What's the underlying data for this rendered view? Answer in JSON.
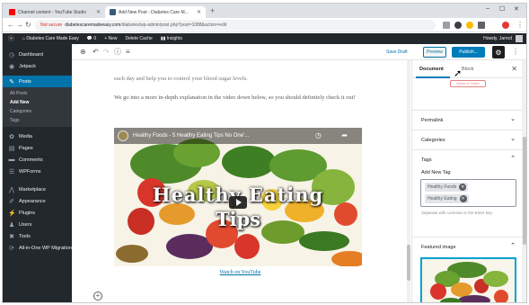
{
  "browser": {
    "tabs": [
      {
        "label": "Channel content - YouTube Studio"
      },
      {
        "label": "Add New Post - Diabetes Care M..."
      }
    ],
    "url_warning": "Not secure",
    "url_host": "diabetescaremadeeasy.com",
    "url_path": "/diabetes/wp-admin/post.php?post=1088&action=edit"
  },
  "adminbar": {
    "site_name": "Diabetes Care Made Easy",
    "comments_count": "0",
    "new_label": "+ New",
    "cache_label": "Delete Cache",
    "insights_label": "Insights",
    "howdy": "Howdy, Jarrod"
  },
  "sidebar": {
    "items": [
      {
        "label": "Dashboard",
        "icon": "dashboard-icon"
      },
      {
        "label": "Jetpack",
        "icon": "jetpack-icon"
      },
      {
        "label": "Posts",
        "icon": "pin-icon"
      },
      {
        "label": "Media",
        "icon": "media-icon"
      },
      {
        "label": "Pages",
        "icon": "pages-icon"
      },
      {
        "label": "Comments",
        "icon": "comments-icon"
      },
      {
        "label": "WPForms",
        "icon": "forms-icon"
      },
      {
        "label": "Marketplace",
        "icon": "marketplace-icon"
      },
      {
        "label": "Appearance",
        "icon": "brush-icon"
      },
      {
        "label": "Plugins",
        "icon": "plugin-icon"
      },
      {
        "label": "Users",
        "icon": "users-icon"
      },
      {
        "label": "Tools",
        "icon": "wrench-icon"
      },
      {
        "label": "All-in-One WP Migration",
        "icon": "migration-icon"
      }
    ],
    "posts_submenu": [
      "All Posts",
      "Add New",
      "Categories",
      "Tags"
    ]
  },
  "toolbar": {
    "save_draft": "Save Draft",
    "preview": "Preview",
    "publish": "Publish..."
  },
  "content": {
    "para1": "each day and help you to control your blood sugar levels.",
    "para2": "We go into a more in-depth explanation in the video down below, so you should definitely check it out!",
    "video_title": "Healthy Foods - 5 Healthy Eating Tips No One'...",
    "video_text_line1": "Healthy Eating",
    "video_text_line2": "Tips",
    "watch_link": "Watch on YouTube"
  },
  "panel": {
    "tab_document": "Document",
    "tab_block": "Block",
    "move_to_trash": "Move to Trash",
    "sections": [
      "Permalink",
      "Categories",
      "Tags"
    ],
    "add_new_tag": "Add New Tag",
    "tags": [
      "Healthy Foods",
      "Healthy Eating"
    ],
    "tag_help": "Separate with commas or the Enter key.",
    "featured_image": "Featured image"
  },
  "colors": {
    "admin_dark": "#23282d",
    "wp_blue": "#0073aa",
    "publish_blue": "#007cba"
  }
}
